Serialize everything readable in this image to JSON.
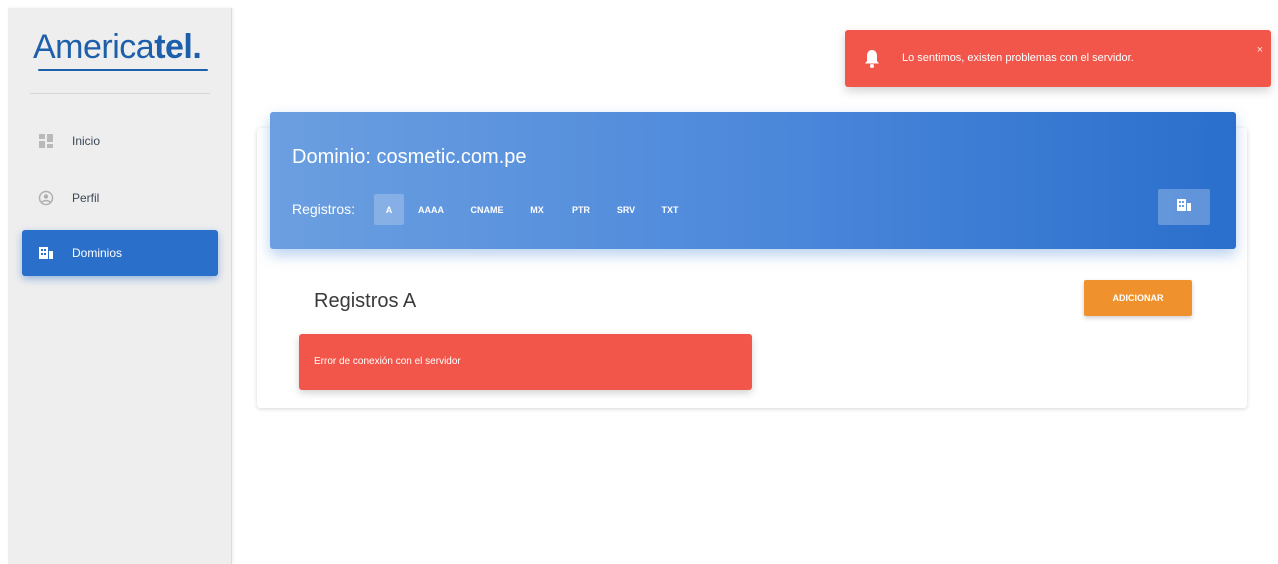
{
  "brand": {
    "name_regular": "America",
    "name_bold": "tel",
    "dot": "."
  },
  "sidebar": {
    "items": [
      {
        "label": "Inicio",
        "icon": "dashboard-icon",
        "active": false
      },
      {
        "label": "Perfil",
        "icon": "user-circle-icon",
        "active": false
      },
      {
        "label": "Dominios",
        "icon": "domain-grid-icon",
        "active": true
      }
    ]
  },
  "notification": {
    "message": "Lo sentimos, existen problemas con el servidor.",
    "close": "×",
    "icon": "bell-icon",
    "color": "#f2564a"
  },
  "domain": {
    "title": "Dominio: cosmetic.com.pe",
    "registros_label": "Registros:",
    "tabs": [
      "A",
      "AAAA",
      "CNAME",
      "MX",
      "PTR",
      "SRV",
      "TXT"
    ],
    "active_tab": "A",
    "header_button_icon": "domain-grid-icon"
  },
  "section": {
    "title": "Registros A",
    "add_button": "ADICIONAR"
  },
  "alert": {
    "message": "Error de conexión con el servidor"
  },
  "colors": {
    "accent": "#2a6fc9",
    "warning": "#ef922e",
    "danger": "#f2564a",
    "sidebar_bg": "#eeeeee"
  }
}
